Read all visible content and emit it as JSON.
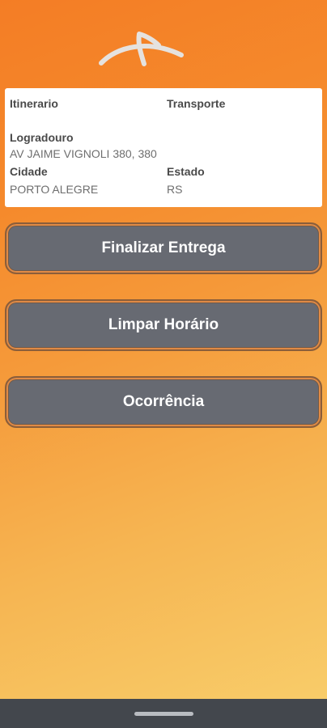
{
  "header": {
    "logo_icon": "arcelor-swoosh-logo",
    "logo_color": "#e5e2df"
  },
  "info_card": {
    "itinerario_label": "Itinerario",
    "itinerario_value": "",
    "transporte_label": "Transporte",
    "transporte_value": "",
    "logradouro_label": "Logradouro",
    "logradouro_value": "AV JAIME VIGNOLI 380, 380",
    "cidade_label": "Cidade",
    "cidade_value": "PORTO ALEGRE",
    "estado_label": "Estado",
    "estado_value": "RS"
  },
  "actions": {
    "finalizar_label": "Finalizar Entrega",
    "limpar_label": "Limpar Horário",
    "ocorrencia_label": "Ocorrência"
  },
  "theme": {
    "gradient_start": "#f47d25",
    "gradient_end": "#f8cf6c",
    "button_color": "#676a72",
    "nav_bar_color": "#43474d"
  },
  "nav_bar": {
    "home_indicator": "home-pill-icon"
  }
}
